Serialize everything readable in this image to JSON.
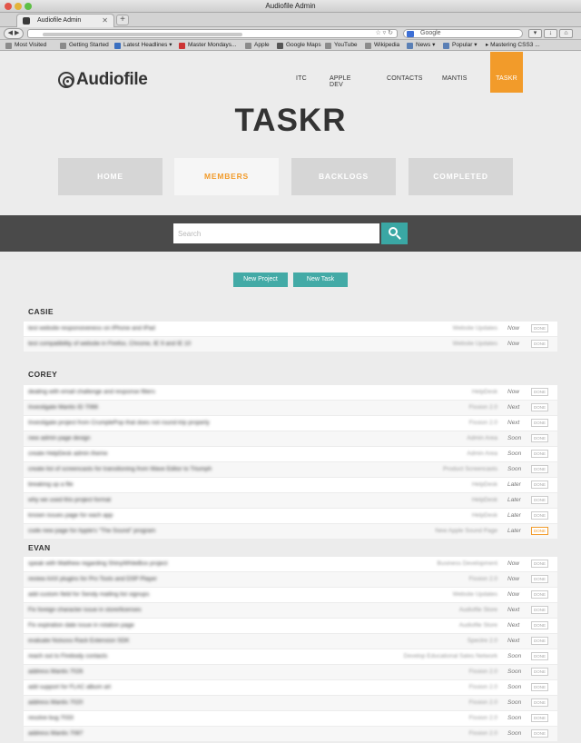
{
  "browser": {
    "window_title": "Audiofile Admin",
    "tab_title": "Audiofile Admin",
    "url": "http://admin.audiofile-engineering.net/tasks/members.php",
    "search_engine_placeholder": "Google",
    "bookmarks": [
      "Most Visited",
      "Getting Started",
      "Latest Headlines",
      "Master Mondays...",
      "Apple",
      "Google Maps",
      "YouTube",
      "Wikipedia",
      "News",
      "Popular",
      "Mastering CSS3 ..."
    ]
  },
  "site": {
    "logo_text": "Audiofile",
    "nav": [
      "ITC",
      "APPLE DEV",
      "CONTACTS",
      "MANTIS",
      "TASKR"
    ],
    "active_nav": "TASKR",
    "heading": "TASKR",
    "tiles": [
      "HOME",
      "MEMBERS",
      "BACKLOGS",
      "COMPLETED"
    ],
    "active_tile": "MEMBERS",
    "search_placeholder": "Search",
    "new_project_label": "New Project",
    "new_task_label": "New Task",
    "accent_color": "#f29b2a",
    "teal_color": "#43aaa6"
  },
  "members": [
    {
      "name": "CASIE",
      "tasks": [
        {
          "task": "test website responsiveness on iPhone and iPad",
          "project": "Website Updates",
          "when": "Now",
          "done": "DONE"
        },
        {
          "task": "test compatibility of website in Firefox, Chrome, IE 9 and IE 10",
          "project": "Website Updates",
          "when": "Now",
          "done": "DONE"
        }
      ]
    },
    {
      "name": "COREY",
      "tasks": [
        {
          "task": "dealing with email challenge and response filters",
          "project": "HelpDesk",
          "when": "Now",
          "done": "DONE"
        },
        {
          "task": "Investigate Mantis ID 7066",
          "project": "Fission 2.0",
          "when": "Next",
          "done": "DONE"
        },
        {
          "task": "Investigate project from CrumplePop that does not round-trip properly",
          "project": "Fission 2.0",
          "when": "Next",
          "done": "DONE"
        },
        {
          "task": "new admin page design",
          "project": "Admin Area",
          "when": "Soon",
          "done": "DONE"
        },
        {
          "task": "create HelpDesk admin theme",
          "project": "Admin Area",
          "when": "Soon",
          "done": "DONE"
        },
        {
          "task": "create list of screencasts for transitioning from Wave Editor to Triumph",
          "project": "Product Screencasts",
          "when": "Soon",
          "done": "DONE"
        },
        {
          "task": "breaking up a file",
          "project": "HelpDesk",
          "when": "Later",
          "done": "DONE"
        },
        {
          "task": "why we used this project format",
          "project": "HelpDesk",
          "when": "Later",
          "done": "DONE"
        },
        {
          "task": "known issues page for each app",
          "project": "HelpDesk",
          "when": "Later",
          "done": "DONE"
        },
        {
          "task": "code new page for Apple's \"The Sound\" program",
          "project": "New Apple Sound Page",
          "when": "Later",
          "done": "DONE"
        }
      ]
    },
    {
      "name": "EVAN",
      "tasks": [
        {
          "task": "speak with Matthew regarding ShinyWhiteBox project",
          "project": "Business Development",
          "when": "Now",
          "done": "DONE"
        },
        {
          "task": "review AAX plugins for Pro Tools and DSP Player",
          "project": "Fission 2.0",
          "when": "Now",
          "done": "DONE"
        },
        {
          "task": "add custom field for Sendy mailing list signups",
          "project": "Website Updates",
          "when": "Now",
          "done": "DONE"
        },
        {
          "task": "Fix foreign character issue in store/licenses",
          "project": "Audiofile Store",
          "when": "Next",
          "done": "DONE"
        },
        {
          "task": "Fix expiration date issue in rotation page",
          "project": "Audiofile Store",
          "when": "Next",
          "done": "DONE"
        },
        {
          "task": "evaluate Noisoss Rack Extension SDK",
          "project": "Spectre 2.0",
          "when": "Next",
          "done": "DONE"
        },
        {
          "task": "reach out to Firebody contacts",
          "project": "Develop Educational Sales Network",
          "when": "Soon",
          "done": "DONE"
        },
        {
          "task": "address Mantis 7026",
          "project": "Fission 2.0",
          "when": "Soon",
          "done": "DONE"
        },
        {
          "task": "add support for FLAC album art",
          "project": "Fission 2.0",
          "when": "Soon",
          "done": "DONE"
        },
        {
          "task": "address Mantis 7020",
          "project": "Fission 2.0",
          "when": "Soon",
          "done": "DONE"
        },
        {
          "task": "resolve bug 7033",
          "project": "Fission 2.0",
          "when": "Soon",
          "done": "DONE"
        },
        {
          "task": "address Mantis 7087",
          "project": "Fission 2.0",
          "when": "Soon",
          "done": "DONE"
        }
      ]
    }
  ]
}
